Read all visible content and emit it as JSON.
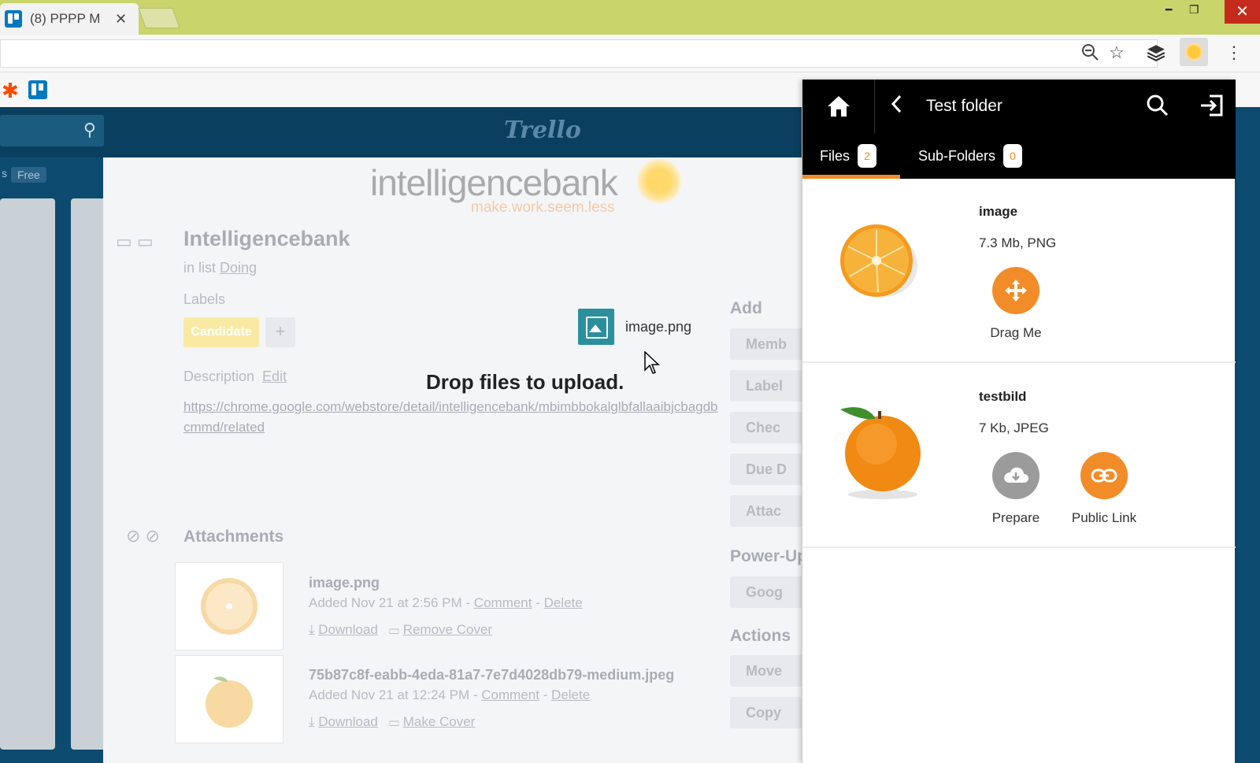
{
  "browser": {
    "tab_title": "(8) PPPP M",
    "tab_close": "✕"
  },
  "trello": {
    "logo_text": "Trello",
    "free_badge": "Free",
    "s_label": "s"
  },
  "modal": {
    "brand_text": "intelligencebank",
    "brand_tagline": "make.work.seem.less",
    "card_title": "Intelligencebank",
    "in_list_prefix": "in list",
    "list_name": "Doing",
    "labels_heading": "Labels",
    "label_text": "Candidate",
    "label_add": "+",
    "description_heading": "Description",
    "description_edit": "Edit",
    "description_link": "https://chrome.google.com/webstore/detail/intelligencebank/mbimbbokalglbfallaaibjcbagdbcmmd/related",
    "attachments_heading": "Attachments",
    "attachments": [
      {
        "name": "image.png",
        "added": "Added Nov 21 at 2:56 PM",
        "sep1": " - ",
        "comment": "Comment",
        "sep2": " - ",
        "delete": "Delete",
        "download": "Download",
        "cover_action": "Remove Cover"
      },
      {
        "name": "75b87c8f-eabb-4eda-81a7-7e7d4028db79-medium.jpeg",
        "added": "Added Nov 21 at 12:24 PM",
        "sep1": " - ",
        "comment": "Comment",
        "sep2": " - ",
        "delete": "Delete",
        "download": "Download",
        "cover_action": "Make Cover"
      }
    ],
    "add_heading": "Add",
    "add_buttons": [
      "Memb",
      "Label",
      "Chec",
      "Due D",
      "Attac"
    ],
    "powerups_heading": "Power-Up",
    "powerup_buttons": [
      "Goog"
    ],
    "actions_heading": "Actions",
    "action_buttons": [
      "Move",
      "Copy"
    ]
  },
  "drop_overlay": {
    "file_name": "image.png",
    "message": "Drop files to upload."
  },
  "panel": {
    "folder_title": "Test folder",
    "tabs": [
      {
        "label": "Files",
        "count": "2"
      },
      {
        "label": "Sub-Folders",
        "count": "0"
      }
    ],
    "files": [
      {
        "name": "image",
        "meta": "7.3 Mb, PNG",
        "actions": [
          {
            "label": "Drag Me",
            "icon": "move-icon",
            "color": "#f28c28"
          }
        ]
      },
      {
        "name": "testbild",
        "meta": "7 Kb, JPEG",
        "actions": [
          {
            "label": "Prepare",
            "icon": "cloud-download-icon",
            "color": "#9b9b9b"
          },
          {
            "label": "Public Link",
            "icon": "link-icon",
            "color": "#f28c28"
          }
        ]
      }
    ]
  },
  "colors": {
    "accent": "#f28c28",
    "panel_header": "#000000",
    "trello_header": "#0b3f60",
    "title_bar": "#c9d46a"
  }
}
